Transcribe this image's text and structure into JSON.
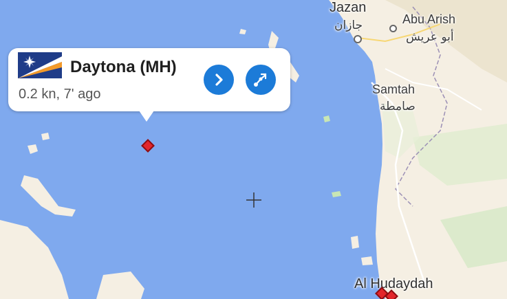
{
  "map": {
    "labels": {
      "jazan": "Jazan",
      "jazan_ar": "جازان",
      "abu_arish": "Abu Arish",
      "abu_arish_ar": "أبو عريش",
      "samtah": "Samtah",
      "samtah_ar": "صامطة",
      "al_hudaydah": "Al Hudaydah"
    },
    "colors": {
      "sea": "#7fa9ee",
      "land": "#f5efe3",
      "vessel": "#e3262b",
      "button": "#1c7bd8"
    }
  },
  "popup": {
    "vessel_name": "Daytona (MH)",
    "status": "0.2 kn, 7' ago",
    "flag_icon": "marshall-islands-flag",
    "next_button_icon": "chevron-right-icon",
    "route_button_icon": "route-icon"
  }
}
